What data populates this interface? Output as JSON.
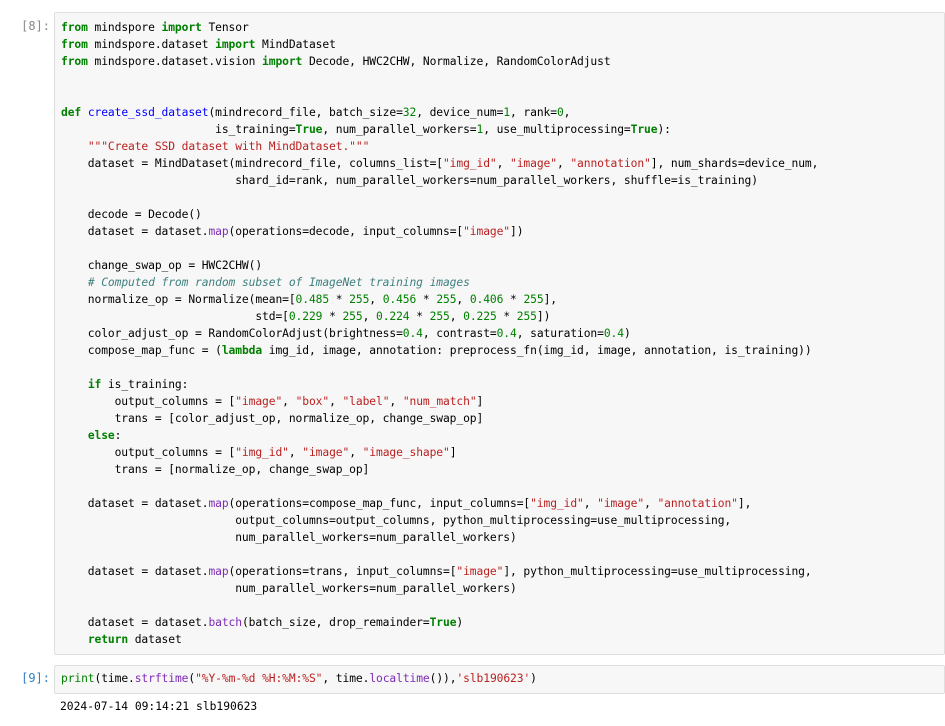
{
  "cells": [
    {
      "prompt": "[8]:",
      "lines": [
        [
          [
            "kw",
            "from"
          ],
          [
            "t",
            " mindspore "
          ],
          [
            "kw",
            "import"
          ],
          [
            "t",
            " Tensor"
          ]
        ],
        [
          [
            "kw",
            "from"
          ],
          [
            "t",
            " mindspore.dataset "
          ],
          [
            "kw",
            "import"
          ],
          [
            "t",
            " MindDataset"
          ]
        ],
        [
          [
            "kw",
            "from"
          ],
          [
            "t",
            " mindspore.dataset.vision "
          ],
          [
            "kw",
            "import"
          ],
          [
            "t",
            " Decode, HWC2CHW, Normalize, RandomColorAdjust"
          ]
        ],
        [
          [
            "t",
            ""
          ]
        ],
        [
          [
            "t",
            ""
          ]
        ],
        [
          [
            "kw",
            "def"
          ],
          [
            "t",
            " "
          ],
          [
            "nf",
            "create_ssd_dataset"
          ],
          [
            "t",
            "(mindrecord_file, batch_size="
          ],
          [
            "nu",
            "32"
          ],
          [
            "t",
            ", device_num="
          ],
          [
            "nu",
            "1"
          ],
          [
            "t",
            ", rank="
          ],
          [
            "nu",
            "0"
          ],
          [
            "t",
            ","
          ]
        ],
        [
          [
            "t",
            "                       is_training="
          ],
          [
            "kw",
            "True"
          ],
          [
            "t",
            ", num_parallel_workers="
          ],
          [
            "nu",
            "1"
          ],
          [
            "t",
            ", use_multiprocessing="
          ],
          [
            "kw",
            "True"
          ],
          [
            "t",
            "):"
          ]
        ],
        [
          [
            "t",
            "    "
          ],
          [
            "st",
            "\"\"\"Create SSD dataset with MindDataset.\"\"\""
          ]
        ],
        [
          [
            "t",
            "    dataset = MindDataset(mindrecord_file, columns_list=["
          ],
          [
            "st",
            "\"img_id\""
          ],
          [
            "t",
            ", "
          ],
          [
            "st",
            "\"image\""
          ],
          [
            "t",
            ", "
          ],
          [
            "st",
            "\"annotation\""
          ],
          [
            "t",
            "], num_shards=device_num,"
          ]
        ],
        [
          [
            "t",
            "                          shard_id=rank, num_parallel_workers=num_parallel_workers, shuffle=is_training)"
          ]
        ],
        [
          [
            "t",
            ""
          ]
        ],
        [
          [
            "t",
            "    decode = Decode()"
          ]
        ],
        [
          [
            "t",
            "    dataset = dataset."
          ],
          [
            "at",
            "map"
          ],
          [
            "t",
            "(operations=decode, input_columns=["
          ],
          [
            "st",
            "\"image\""
          ],
          [
            "t",
            "])"
          ]
        ],
        [
          [
            "t",
            ""
          ]
        ],
        [
          [
            "t",
            "    change_swap_op = HWC2CHW()"
          ]
        ],
        [
          [
            "t",
            "    "
          ],
          [
            "cm",
            "# Computed from random subset of ImageNet training images"
          ]
        ],
        [
          [
            "t",
            "    normalize_op = Normalize(mean=["
          ],
          [
            "nu",
            "0.485"
          ],
          [
            "t",
            " * "
          ],
          [
            "nu",
            "255"
          ],
          [
            "t",
            ", "
          ],
          [
            "nu",
            "0.456"
          ],
          [
            "t",
            " * "
          ],
          [
            "nu",
            "255"
          ],
          [
            "t",
            ", "
          ],
          [
            "nu",
            "0.406"
          ],
          [
            "t",
            " * "
          ],
          [
            "nu",
            "255"
          ],
          [
            "t",
            "],"
          ]
        ],
        [
          [
            "t",
            "                             std=["
          ],
          [
            "nu",
            "0.229"
          ],
          [
            "t",
            " * "
          ],
          [
            "nu",
            "255"
          ],
          [
            "t",
            ", "
          ],
          [
            "nu",
            "0.224"
          ],
          [
            "t",
            " * "
          ],
          [
            "nu",
            "255"
          ],
          [
            "t",
            ", "
          ],
          [
            "nu",
            "0.225"
          ],
          [
            "t",
            " * "
          ],
          [
            "nu",
            "255"
          ],
          [
            "t",
            "])"
          ]
        ],
        [
          [
            "t",
            "    color_adjust_op = RandomColorAdjust(brightness="
          ],
          [
            "nu",
            "0.4"
          ],
          [
            "t",
            ", contrast="
          ],
          [
            "nu",
            "0.4"
          ],
          [
            "t",
            ", saturation="
          ],
          [
            "nu",
            "0.4"
          ],
          [
            "t",
            ")"
          ]
        ],
        [
          [
            "t",
            "    compose_map_func = ("
          ],
          [
            "kw",
            "lambda"
          ],
          [
            "t",
            " img_id, image, annotation: preprocess_fn(img_id, image, annotation, is_training))"
          ]
        ],
        [
          [
            "t",
            ""
          ]
        ],
        [
          [
            "t",
            "    "
          ],
          [
            "kw",
            "if"
          ],
          [
            "t",
            " is_training:"
          ]
        ],
        [
          [
            "t",
            "        output_columns = ["
          ],
          [
            "st",
            "\"image\""
          ],
          [
            "t",
            ", "
          ],
          [
            "st",
            "\"box\""
          ],
          [
            "t",
            ", "
          ],
          [
            "st",
            "\"label\""
          ],
          [
            "t",
            ", "
          ],
          [
            "st",
            "\"num_match\""
          ],
          [
            "t",
            "]"
          ]
        ],
        [
          [
            "t",
            "        trans = [color_adjust_op, normalize_op, change_swap_op]"
          ]
        ],
        [
          [
            "t",
            "    "
          ],
          [
            "kw",
            "else"
          ],
          [
            "t",
            ":"
          ]
        ],
        [
          [
            "t",
            "        output_columns = ["
          ],
          [
            "st",
            "\"img_id\""
          ],
          [
            "t",
            ", "
          ],
          [
            "st",
            "\"image\""
          ],
          [
            "t",
            ", "
          ],
          [
            "st",
            "\"image_shape\""
          ],
          [
            "t",
            "]"
          ]
        ],
        [
          [
            "t",
            "        trans = [normalize_op, change_swap_op]"
          ]
        ],
        [
          [
            "t",
            ""
          ]
        ],
        [
          [
            "t",
            "    dataset = dataset."
          ],
          [
            "at",
            "map"
          ],
          [
            "t",
            "(operations=compose_map_func, input_columns=["
          ],
          [
            "st",
            "\"img_id\""
          ],
          [
            "t",
            ", "
          ],
          [
            "st",
            "\"image\""
          ],
          [
            "t",
            ", "
          ],
          [
            "st",
            "\"annotation\""
          ],
          [
            "t",
            "],"
          ]
        ],
        [
          [
            "t",
            "                          output_columns=output_columns, python_multiprocessing=use_multiprocessing,"
          ]
        ],
        [
          [
            "t",
            "                          num_parallel_workers=num_parallel_workers)"
          ]
        ],
        [
          [
            "t",
            ""
          ]
        ],
        [
          [
            "t",
            "    dataset = dataset."
          ],
          [
            "at",
            "map"
          ],
          [
            "t",
            "(operations=trans, input_columns=["
          ],
          [
            "st",
            "\"image\""
          ],
          [
            "t",
            "], python_multiprocessing=use_multiprocessing,"
          ]
        ],
        [
          [
            "t",
            "                          num_parallel_workers=num_parallel_workers)"
          ]
        ],
        [
          [
            "t",
            ""
          ]
        ],
        [
          [
            "t",
            "    dataset = dataset."
          ],
          [
            "at",
            "batch"
          ],
          [
            "t",
            "(batch_size, drop_remainder="
          ],
          [
            "kw",
            "True"
          ],
          [
            "t",
            ")"
          ]
        ],
        [
          [
            "t",
            "    "
          ],
          [
            "kw",
            "return"
          ],
          [
            "t",
            " dataset"
          ]
        ]
      ]
    },
    {
      "prompt": "[9]:",
      "lines": [
        [
          [
            "bi",
            "print"
          ],
          [
            "t",
            "(time."
          ],
          [
            "at",
            "strftime"
          ],
          [
            "t",
            "("
          ],
          [
            "st",
            "\"%Y-%m-%d %H:%M:%S\""
          ],
          [
            "t",
            ", time."
          ],
          [
            "at",
            "localtime"
          ],
          [
            "t",
            "()),"
          ],
          [
            "st",
            "'slb190623'"
          ],
          [
            "t",
            ")"
          ]
        ]
      ],
      "output": "2024-07-14 09:14:21 slb190623"
    }
  ]
}
